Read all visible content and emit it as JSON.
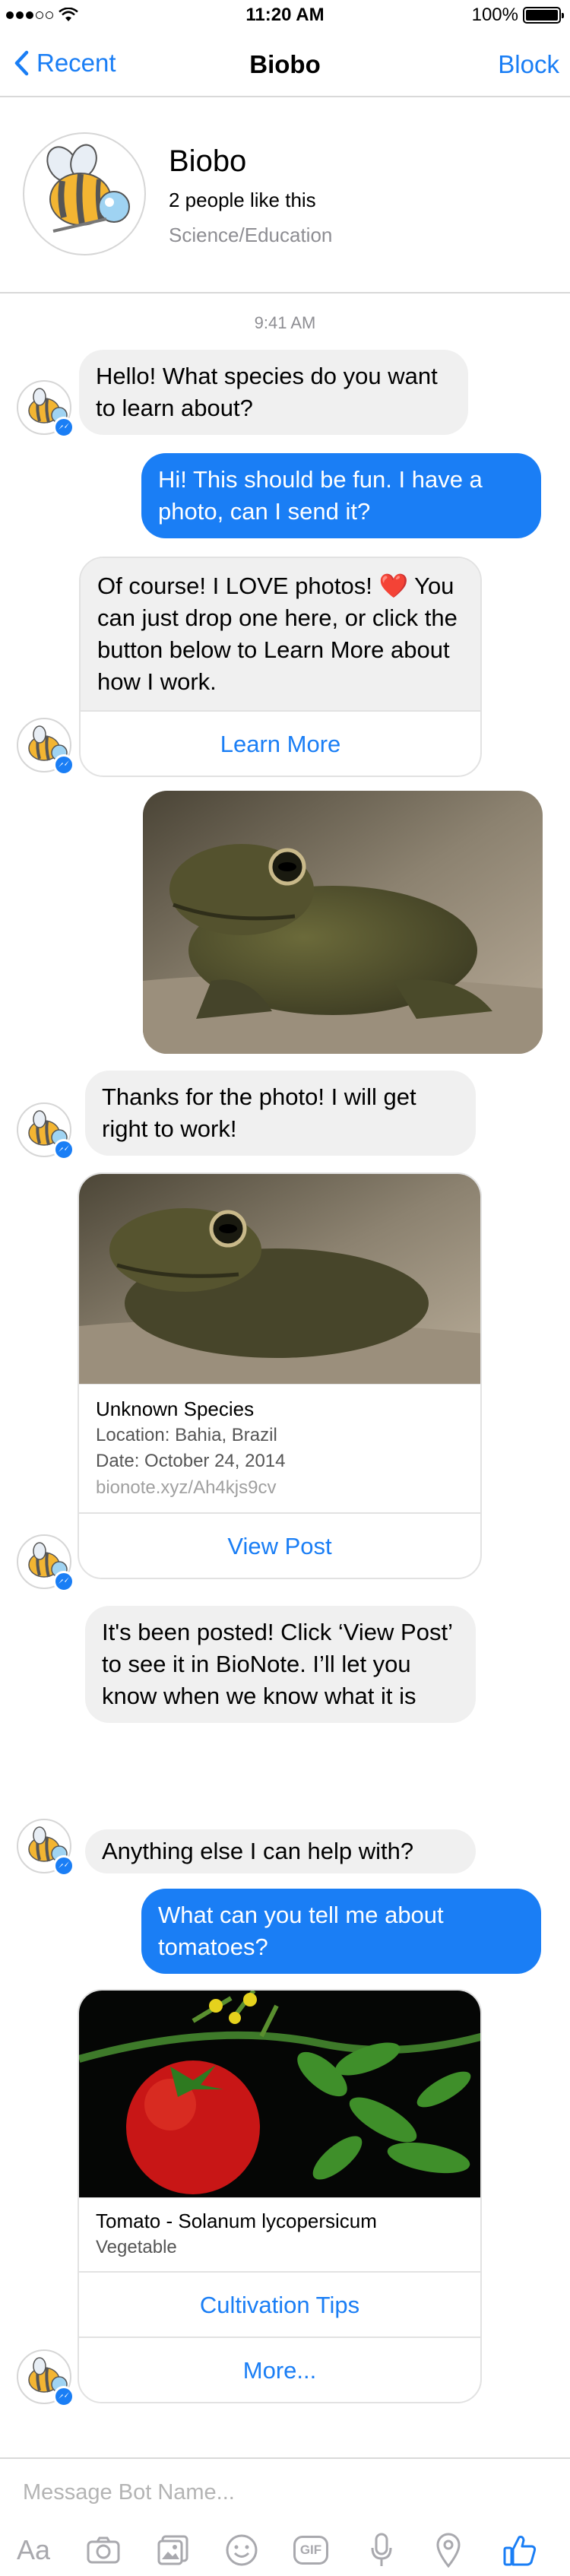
{
  "status_bar": {
    "time": "11:20 AM",
    "battery": "100%"
  },
  "nav": {
    "back_label": "Recent",
    "title": "Biobo",
    "block_label": "Block"
  },
  "profile": {
    "name": "Biobo",
    "likes": "2 people like this",
    "category": "Science/Education"
  },
  "timestamp": "9:41 AM",
  "messages": {
    "m1": "Hello! What species do you want to learn about?",
    "m2": "Hi! This should be fun. I have a photo, can I send it?",
    "m3": "Of course! I LOVE photos! ❤️ You can just drop one here, or click the button below to Learn More about how I work.",
    "m3_button": "Learn More",
    "m5": "Thanks for the photo! I will get right to work!",
    "m7": "It's been posted! Click ‘View Post’ to see it in BioNote. I’ll let you know when we know what it is",
    "m8": "Anything else I can help with?",
    "m9": "What can you tell me about tomatoes?"
  },
  "frog_card": {
    "title": "Unknown Species",
    "location": "Location: Bahia, Brazil",
    "date": "Date: October 24, 2014",
    "link": "bionote.xyz/Ah4kjs9cv",
    "button": "View Post"
  },
  "tomato_card": {
    "title": "Tomato - Solanum lycopersicum",
    "subtitle": "Vegetable",
    "button1": "Cultivation Tips",
    "button2": "More..."
  },
  "composer": {
    "placeholder": "Message Bot Name...",
    "aa_label": "Aa",
    "gif_label": "GIF"
  },
  "colors": {
    "accent": "#1a7ef5",
    "incoming_bubble": "#f0f0f0",
    "muted": "#8e8e93"
  }
}
